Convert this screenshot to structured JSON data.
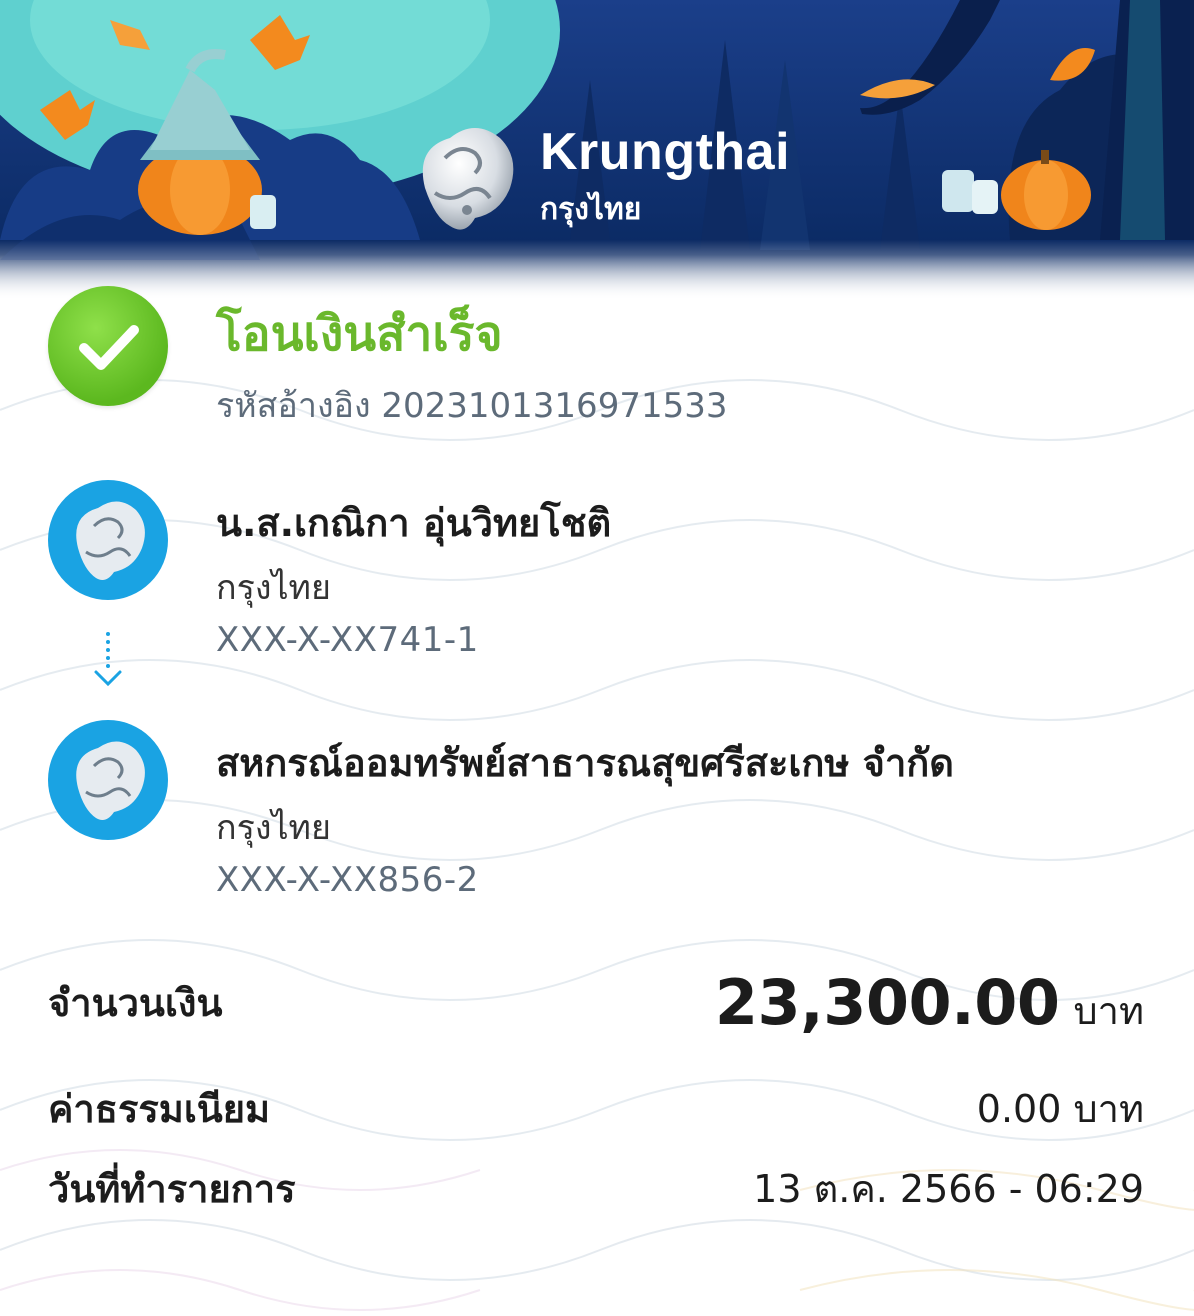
{
  "brand": {
    "name_en": "Krungthai",
    "name_th": "กรุงไทย"
  },
  "status": {
    "title": "โอนเงินสำเร็จ",
    "ref_label": "รหัสอ้างอิง",
    "ref_no": "2023101316971533"
  },
  "sender": {
    "name": "น.ส.เกณิกา อุ่นวิทยโชติ",
    "bank": "กรุงไทย",
    "account": "XXX-X-XX741-1"
  },
  "receiver": {
    "name": "สหกรณ์ออมทรัพย์สาธารณสุขศรีสะเกษ จำกัด",
    "bank": "กรุงไทย",
    "account": "XXX-X-XX856-2"
  },
  "summary": {
    "amount_label": "จำนวนเงิน",
    "amount_value": "23,300.00",
    "amount_unit": "บาท",
    "fee_label": "ค่าธรรมเนียม",
    "fee_value": "0.00 บาท",
    "date_label": "วันที่ทำรายการ",
    "date_value": "13 ต.ค. 2566 - 06:29"
  },
  "colors": {
    "success": "#6ab82c",
    "bank_blue": "#1aa3e3",
    "header_navy": "#0b2a63"
  },
  "icons": {
    "status": "check-circle-icon",
    "bank": "krungthai-logo-icon",
    "transfer_arrow": "arrow-down-dotted-icon"
  }
}
